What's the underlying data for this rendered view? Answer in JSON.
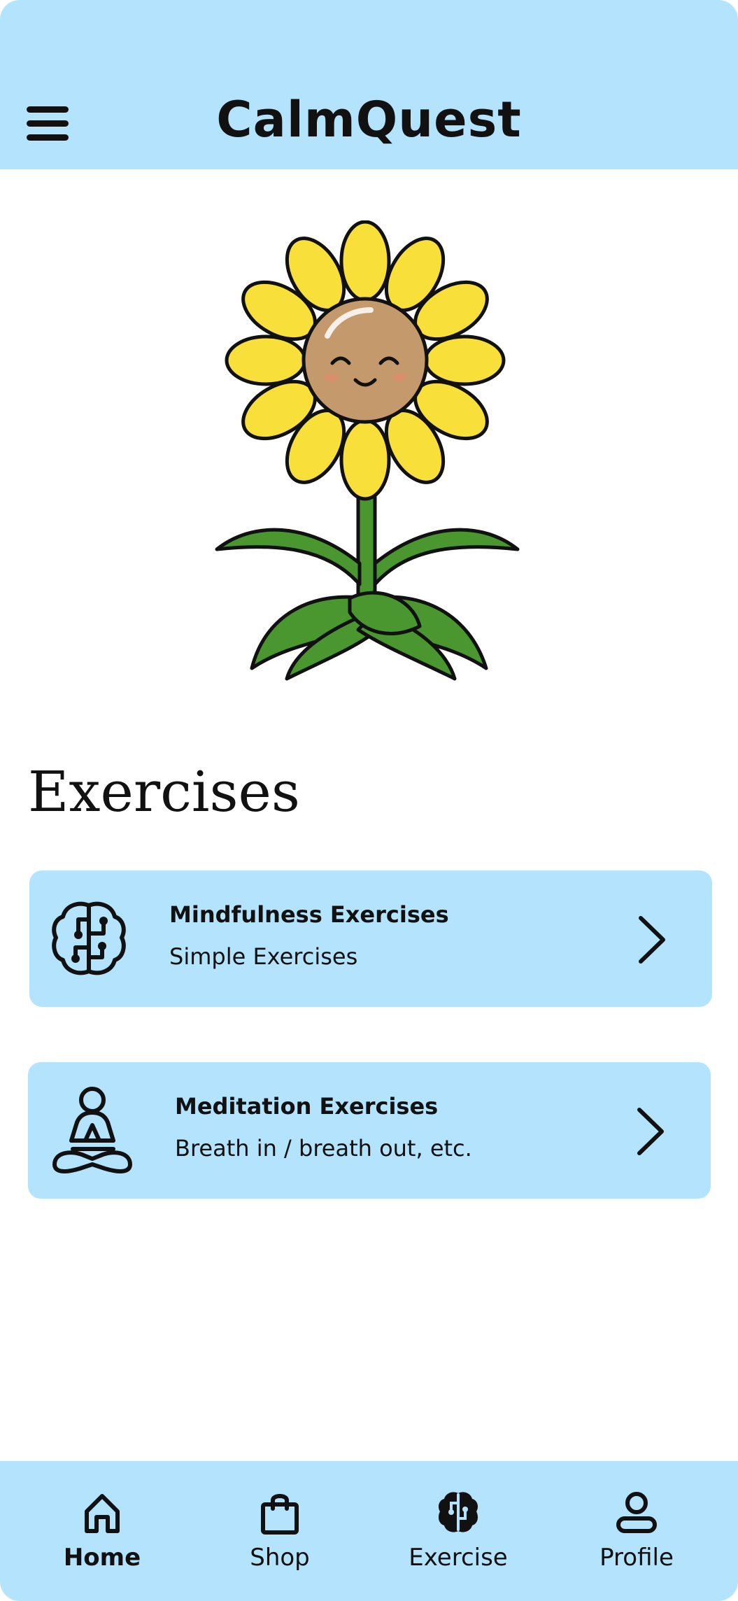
{
  "header": {
    "title": "CalmQuest",
    "menu_icon": "hamburger-menu-icon",
    "background": "#b3e3fd"
  },
  "mascot": {
    "icon": "smiling-sunflower"
  },
  "exercises": {
    "heading": "Exercises",
    "items": [
      {
        "icon": "brain-circuit-icon",
        "title": "Mindfulness Exercises",
        "subtitle": "Simple Exercises"
      },
      {
        "icon": "meditation-pose-icon",
        "title": "Meditation Exercises",
        "subtitle": "Breath in / breath out, etc."
      }
    ]
  },
  "bottom_nav": {
    "items": [
      {
        "label": "Home",
        "icon": "home-icon",
        "active": true
      },
      {
        "label": "Shop",
        "icon": "shopping-bag-icon",
        "active": false
      },
      {
        "label": "Exercise",
        "icon": "brain-icon",
        "active": false
      },
      {
        "label": "Profile",
        "icon": "user-icon",
        "active": false
      }
    ]
  },
  "colors": {
    "accent": "#b3e3fd",
    "petal": "#f9df3a",
    "flower_center": "#c49a6c",
    "leaf": "#4a962f"
  }
}
